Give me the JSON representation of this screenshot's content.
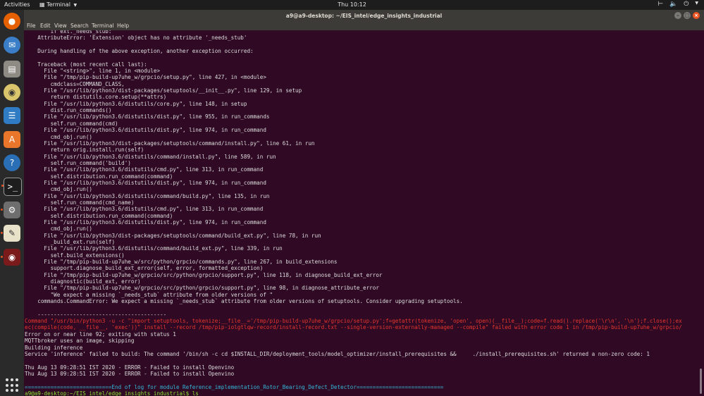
{
  "topbar": {
    "activities": "Activities",
    "app_menu": "Terminal",
    "clock": "Thu 10:12",
    "icons": [
      "network-icon",
      "volume-icon",
      "power-icon"
    ]
  },
  "dock": {
    "items": [
      "firefox-icon",
      "thunderbird-icon",
      "files-icon",
      "rhythmbox-icon",
      "writer-icon",
      "software-center-icon",
      "help-icon",
      "terminal-icon",
      "settings-icon",
      "text-editor-icon",
      "recorder-icon"
    ],
    "grid": "show-applications-icon"
  },
  "window": {
    "title": "a9@a9-desktop: ~/EIS_intel/edge_insights_industrial",
    "close": "×",
    "menu": [
      "File",
      "Edit",
      "View",
      "Search",
      "Terminal",
      "Help"
    ]
  },
  "terminal": {
    "lines": [
      {
        "t": "        if ext._needs_stub:",
        "k": ""
      },
      {
        "t": "    AttributeError: 'Extension' object has no attribute '_needs_stub'",
        "k": ""
      },
      {
        "t": "",
        "k": ""
      },
      {
        "t": "    During handling of the above exception, another exception occurred:",
        "k": ""
      },
      {
        "t": "",
        "k": ""
      },
      {
        "t": "    Traceback (most recent call last):",
        "k": ""
      },
      {
        "t": "      File \"<string>\", line 1, in <module>",
        "k": ""
      },
      {
        "t": "      File \"/tmp/pip-build-up7uhe_w/grpcio/setup.py\", line 427, in <module>",
        "k": ""
      },
      {
        "t": "        cmdclass=COMMAND_CLASS,",
        "k": ""
      },
      {
        "t": "      File \"/usr/lib/python3/dist-packages/setuptools/__init__.py\", line 129, in setup",
        "k": ""
      },
      {
        "t": "        return distutils.core.setup(**attrs)",
        "k": ""
      },
      {
        "t": "      File \"/usr/lib/python3.6/distutils/core.py\", line 148, in setup",
        "k": ""
      },
      {
        "t": "        dist.run_commands()",
        "k": ""
      },
      {
        "t": "      File \"/usr/lib/python3.6/distutils/dist.py\", line 955, in run_commands",
        "k": ""
      },
      {
        "t": "        self.run_command(cmd)",
        "k": ""
      },
      {
        "t": "      File \"/usr/lib/python3.6/distutils/dist.py\", line 974, in run_command",
        "k": ""
      },
      {
        "t": "        cmd_obj.run()",
        "k": ""
      },
      {
        "t": "      File \"/usr/lib/python3/dist-packages/setuptools/command/install.py\", line 61, in run",
        "k": ""
      },
      {
        "t": "        return orig.install.run(self)",
        "k": ""
      },
      {
        "t": "      File \"/usr/lib/python3.6/distutils/command/install.py\", line 589, in run",
        "k": ""
      },
      {
        "t": "        self.run_command('build')",
        "k": ""
      },
      {
        "t": "      File \"/usr/lib/python3.6/distutils/cmd.py\", line 313, in run_command",
        "k": ""
      },
      {
        "t": "        self.distribution.run_command(command)",
        "k": ""
      },
      {
        "t": "      File \"/usr/lib/python3.6/distutils/dist.py\", line 974, in run_command",
        "k": ""
      },
      {
        "t": "        cmd_obj.run()",
        "k": ""
      },
      {
        "t": "      File \"/usr/lib/python3.6/distutils/command/build.py\", line 135, in run",
        "k": ""
      },
      {
        "t": "        self.run_command(cmd_name)",
        "k": ""
      },
      {
        "t": "      File \"/usr/lib/python3.6/distutils/cmd.py\", line 313, in run_command",
        "k": ""
      },
      {
        "t": "        self.distribution.run_command(command)",
        "k": ""
      },
      {
        "t": "      File \"/usr/lib/python3.6/distutils/dist.py\", line 974, in run_command",
        "k": ""
      },
      {
        "t": "        cmd_obj.run()",
        "k": ""
      },
      {
        "t": "      File \"/usr/lib/python3/dist-packages/setuptools/command/build_ext.py\", line 78, in run",
        "k": ""
      },
      {
        "t": "        _build_ext.run(self)",
        "k": ""
      },
      {
        "t": "      File \"/usr/lib/python3.6/distutils/command/build_ext.py\", line 339, in run",
        "k": ""
      },
      {
        "t": "        self.build_extensions()",
        "k": ""
      },
      {
        "t": "      File \"/tmp/pip-build-up7uhe_w/src/python/grpcio/commands.py\", line 267, in build_extensions",
        "k": ""
      },
      {
        "t": "        support.diagnose_build_ext_error(self, error, formatted_exception)",
        "k": ""
      },
      {
        "t": "      File \"/tmp/pip-build-up7uhe_w/grpcio/src/python/grpcio/support.py\", line 118, in diagnose_build_ext_error",
        "k": ""
      },
      {
        "t": "        diagnostic(build_ext, error)",
        "k": ""
      },
      {
        "t": "      File \"/tmp/pip-build-up7uhe_w/grpcio/src/python/grpcio/support.py\", line 98, in diagnose_attribute_error",
        "k": ""
      },
      {
        "t": "        \"We expect a missing `_needs_stub` attribute from older versions of \"",
        "k": ""
      },
      {
        "t": "    commands.CommandError: We expect a missing `_needs_stub` attribute from older versions of setuptools. Consider upgrading setuptools.",
        "k": ""
      },
      {
        "t": "",
        "k": ""
      },
      {
        "t": "    ----------------------------------------",
        "k": ""
      },
      {
        "t": "Command \"/usr/bin/python3 -u -c \"import setuptools, tokenize;__file__='/tmp/pip-build-up7uhe_w/grpcio/setup.py';f=getattr(tokenize, 'open', open)(__file__);code=f.read().replace('\\r\\n', '\\n');f.close();ex",
        "k": "err"
      },
      {
        "t": "ec(compile(code, __file__, 'exec'))\" install --record /tmp/pip-iolgtlqw-record/install-record.txt --single-version-externally-managed --compile\" failed with error code 1 in /tmp/pip-build-up7uhe_w/grpcio/",
        "k": "err"
      },
      {
        "t": "Error on or near line 92; exiting with status 1",
        "k": ""
      },
      {
        "t": "MQTTbroker uses an image, skipping",
        "k": ""
      },
      {
        "t": "Building inference",
        "k": ""
      },
      {
        "t": "Service 'inference' failed to build: The command '/bin/sh -c cd $INSTALL_DIR/deployment_tools/model_optimizer/install_prerequisites &&     ./install_prerequisites.sh' returned a non-zero code: 1",
        "k": ""
      },
      {
        "t": "",
        "k": ""
      },
      {
        "t": "Thu Aug 13 09:28:51 IST 2020 - ERROR - Failed to install Openvino",
        "k": ""
      },
      {
        "t": "Thu Aug 13 09:28:51 IST 2020 - ERROR - Failed to install Openvino",
        "k": ""
      },
      {
        "t": "",
        "k": ""
      },
      {
        "t": "===========================End of log for module Reference_implementation_Rotor_Bearing_Defect_Detector===========================",
        "k": "sep"
      },
      {
        "t": "a9@a9-desktop:~/EIS_intel/edge_insights_industrial$ ls",
        "k": "prompt"
      }
    ]
  }
}
